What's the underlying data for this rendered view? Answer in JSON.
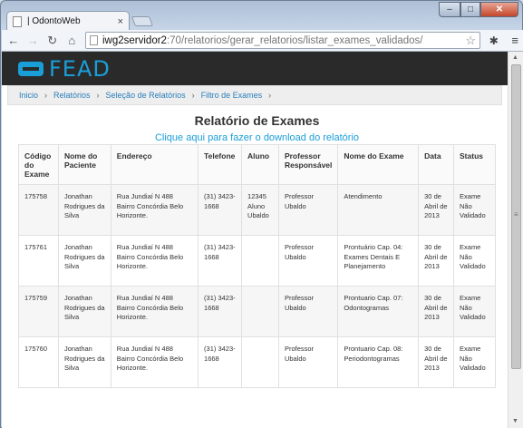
{
  "browser": {
    "tab_title": "| OdontoWeb",
    "tab_close": "×",
    "url_host": "iwg2servidor2",
    "url_path": ":70/relatorios/gerar_relatorios/listar_exames_validados/"
  },
  "site": {
    "logo_text": "FEAD",
    "brand_color": "#1a9ed8"
  },
  "breadcrumb": [
    "Inicio",
    "Relatórios",
    "Seleção de Relatórios",
    "Filtro de Exames"
  ],
  "page": {
    "title": "Relatório de Exames",
    "download_link": "Clique aqui para fazer o download do relatório"
  },
  "table": {
    "headers": [
      "Código do Exame",
      "Nome do Paciente",
      "Endereço",
      "Telefone",
      "Aluno",
      "Professor Responsável",
      "Nome do Exame",
      "Data",
      "Status"
    ],
    "rows": [
      [
        "175758",
        "Jonathan Rodrigues da Silva",
        "Rua Jundiaí N 488 Bairro Concórdia Belo Horizonte.",
        "(31) 3423-1668",
        "12345 Aluno Ubaldo",
        "Professor Ubaldo",
        "Atendimento",
        "30 de Abril de 2013",
        "Exame Não Validado"
      ],
      [
        "175761",
        "Jonathan Rodrigues da Silva",
        "Rua Jundiaí N 488 Bairro Concórdia Belo Horizonte.",
        "(31) 3423-1668",
        "",
        "Professor Ubaldo",
        "Prontuário Cap. 04: Exames Dentais E Planejamento",
        "30 de Abril de 2013",
        "Exame Não Validado"
      ],
      [
        "175759",
        "Jonathan Rodrigues da Silva",
        "Rua Jundiaí N 488 Bairro Concórdia Belo Horizonte.",
        "(31) 3423-1668",
        "",
        "Professor Ubaldo",
        "Prontuario Cap. 07: Odontogramas",
        "30 de Abril de 2013",
        "Exame Não Validado"
      ],
      [
        "175760",
        "Jonathan Rodrigues da Silva",
        "Rua Jundiaí N 488 Bairro Concórdia Belo Horizonte.",
        "(31) 3423-1668",
        "",
        "Professor Ubaldo",
        "Prontuario Cap. 08: Periodontogramas",
        "30 de Abril de 2013",
        "Exame Não Validado"
      ]
    ]
  }
}
